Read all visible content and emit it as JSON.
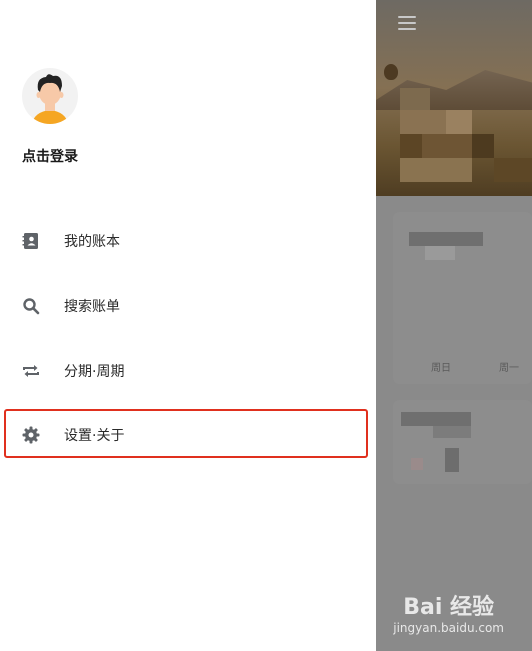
{
  "drawer": {
    "login_label": "点击登录",
    "items": [
      {
        "label": "我的账本",
        "icon": "contacts-book-icon"
      },
      {
        "label": "搜索账单",
        "icon": "search-icon"
      },
      {
        "label": "分期·周期",
        "icon": "repeat-icon"
      },
      {
        "label": "设置·关于",
        "icon": "gear-icon"
      }
    ]
  },
  "background": {
    "weekday_1": "周日",
    "weekday_2": "周一"
  },
  "watermark": {
    "brand": "Bai 经验",
    "domain": "jingyan.baidu.com"
  },
  "colors": {
    "overlay": "#8a8a8a",
    "highlight": "#e0301e",
    "icon": "#5f6368"
  }
}
